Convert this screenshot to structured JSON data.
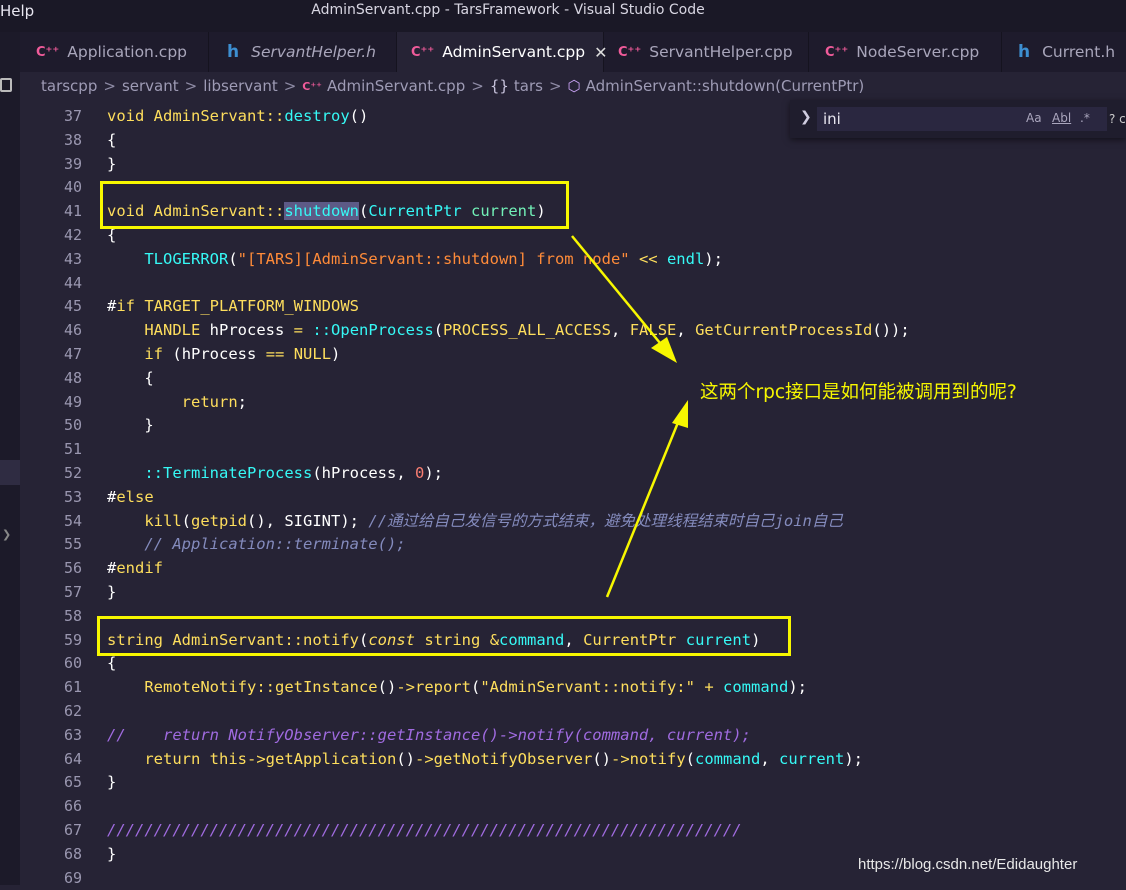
{
  "window": {
    "menu_help": "Help",
    "title": "AdminServant.cpp - TarsFramework - Visual Studio Code"
  },
  "tabs": [
    {
      "icon": "C⁺⁺",
      "label": "Application.cpp",
      "active": false,
      "italic": false
    },
    {
      "icon": "h",
      "label": "ServantHelper.h",
      "active": false,
      "italic": true
    },
    {
      "icon": "C⁺⁺",
      "label": "AdminServant.cpp",
      "active": true,
      "italic": false,
      "close": "✕"
    },
    {
      "icon": "C⁺⁺",
      "label": "ServantHelper.cpp",
      "active": false,
      "italic": false
    },
    {
      "icon": "C⁺⁺",
      "label": "NodeServer.cpp",
      "active": false,
      "italic": false
    },
    {
      "icon": "h",
      "label": "Current.h",
      "active": false,
      "italic": false
    }
  ],
  "breadcrumb": {
    "parts": [
      "tarscpp",
      "servant",
      "libservant"
    ],
    "file": "AdminServant.cpp",
    "namespace": "tars",
    "symbol": "AdminServant::shutdown(CurrentPtr)",
    "separator": ">"
  },
  "search": {
    "value": "ini",
    "case_opt": "Aa",
    "word_opt": "Abl",
    "regex_opt": ".*",
    "more": "? c"
  },
  "annotation": "这两个rpc接口是如何能被调用到的呢?",
  "watermark": "https://blog.csdn.net/Edidaughter",
  "line_numbers": [
    "37",
    "38",
    "39",
    "40",
    "41",
    "42",
    "43",
    "44",
    "45",
    "46",
    "47",
    "48",
    "49",
    "50",
    "51",
    "52",
    "53",
    "54",
    "55",
    "56",
    "57",
    "58",
    "59",
    "60",
    "61",
    "62",
    "63",
    "64",
    "65",
    "66",
    "67",
    "68",
    "69"
  ],
  "code": {
    "l37_kw": "void",
    "l37_cls": "AdminServant",
    "l37_op": "::",
    "l37_fn": "destroy",
    "l37_rest": "()",
    "l38": "{",
    "l39": "}",
    "l41_kw": "void",
    "l41_cls": "AdminServant",
    "l41_op": "::",
    "l41_fn": "shutdown",
    "l41_p1": "(",
    "l41_ty": "CurrentPtr",
    "l41_par": "current",
    "l41_p2": ")",
    "l42": "{",
    "l43_fn": "TLOGERROR",
    "l43_p1": "(",
    "l43_str": "\"[TARS][AdminServant::shutdown] from node\"",
    "l43_op": "<<",
    "l43_end": "endl",
    "l43_p2": ");",
    "l45_hash": "#",
    "l45_kw": "if",
    "l45_def": "TARGET_PLATFORM_WINDOWS",
    "l46_ty": "HANDLE",
    "l46_var": "hProcess",
    "l46_eq": "=",
    "l46_op": "::",
    "l46_fn": "OpenProcess",
    "l46_p1": "(",
    "l46_a1": "PROCESS_ALL_ACCESS",
    "l46_c1": ",",
    "l46_a2": "FALSE",
    "l46_c2": ",",
    "l46_fn2": "GetCurrentProcessId",
    "l46_p2": "());",
    "l47_kw": "if",
    "l47_p1": "(",
    "l47_var": "hProcess",
    "l47_op": "==",
    "l47_null": "NULL",
    "l47_p2": ")",
    "l48": "{",
    "l49_kw": "return",
    "l49_p": ";",
    "l50": "}",
    "l52_op": "::",
    "l52_fn": "TerminateProcess",
    "l52_p1": "(",
    "l52_var": "hProcess",
    "l52_c": ",",
    "l52_num": "0",
    "l52_p2": ");",
    "l53_hash": "#",
    "l53_kw": "else",
    "l54_fn": "kill",
    "l54_p1": "(",
    "l54_fn2": "getpid",
    "l54_p2": "(),",
    "l54_sig": "SIGINT",
    "l54_p3": ");",
    "l54_cm": "//通过给自己发信号的方式结束，避免处理线程结束时自己join自己",
    "l55_cm": "// Application::terminate();",
    "l56_hash": "#",
    "l56_kw": "endif",
    "l57": "}",
    "l59_ty": "string",
    "l59_cls": "AdminServant",
    "l59_op": "::",
    "l59_fn": "notify",
    "l59_p1": "(",
    "l59_const": "const",
    "l59_ty2": "string",
    "l59_amp": "&",
    "l59_par": "command",
    "l59_c": ",",
    "l59_ty3": "CurrentPtr",
    "l59_par2": "current",
    "l59_p2": ")",
    "l60": "{",
    "l61_cls": "RemoteNotify",
    "l61_op": "::",
    "l61_fn": "getInstance",
    "l61_p1": "()",
    "l61_arrow": "->",
    "l61_fn2": "report",
    "l61_p2": "(",
    "l61_str": "\"AdminServant::notify:\"",
    "l61_plus": "+",
    "l61_par": "command",
    "l61_p3": ");",
    "l63_cm": "//    return NotifyObserver::getInstance()->notify(command, current);",
    "l64_kw": "return",
    "l64_this": "this",
    "l64_a1": "->",
    "l64_fn": "getApplication",
    "l64_p1": "()",
    "l64_a2": "->",
    "l64_fn2": "getNotifyObserver",
    "l64_p2": "()",
    "l64_a3": "->",
    "l64_fn3": "notify",
    "l64_p3": "(",
    "l64_par": "command",
    "l64_c": ",",
    "l64_par2": "current",
    "l64_p4": ");",
    "l65": "}",
    "l67_cm": "////////////////////////////////////////////////////////////////////",
    "l68": "}"
  },
  "colors": {
    "background": "#262335",
    "highlight_box": "#f7f700",
    "keyword": "#fede5d",
    "function": "#36f9f6",
    "type": "#fe4450",
    "comment": "#848bbd",
    "string": "#ff8b39",
    "number": "#f97e72",
    "param": "#72f1b8"
  },
  "icons": [
    "cpp-file-icon",
    "header-file-icon",
    "close-icon",
    "braces-icon",
    "symbol-cube-icon",
    "chevron-right-icon",
    "case-sensitive-icon",
    "whole-word-icon",
    "regex-icon",
    "split-editor-icon"
  ]
}
